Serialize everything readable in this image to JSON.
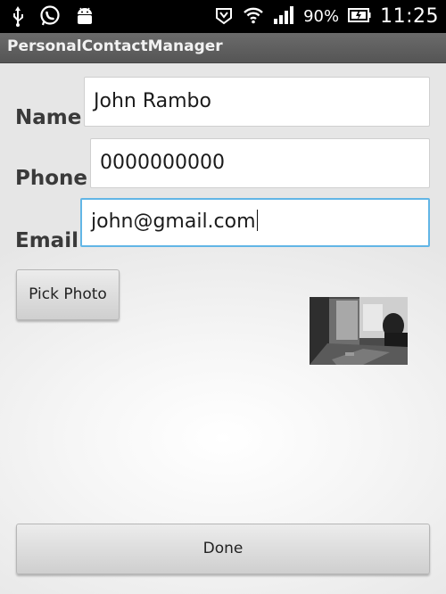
{
  "status_bar": {
    "icons_left": [
      "usb-icon",
      "whatsapp-icon",
      "android-icon"
    ],
    "icons_right": [
      "nfc-icon",
      "wifi-icon",
      "signal-icon",
      "battery-icon"
    ],
    "battery_percent": "90%",
    "time": "11:25"
  },
  "app": {
    "title": "PersonalContactManager"
  },
  "form": {
    "name_label": "Name",
    "name_value": "John Rambo",
    "phone_label": "Phone",
    "phone_value": "0000000000",
    "email_label": "Email",
    "email_value": "john@gmail.com"
  },
  "buttons": {
    "pick_photo": "Pick Photo",
    "done": "Done"
  },
  "colors": {
    "focus_border": "#62b6e6",
    "title_bar": "#5e5e5e"
  }
}
